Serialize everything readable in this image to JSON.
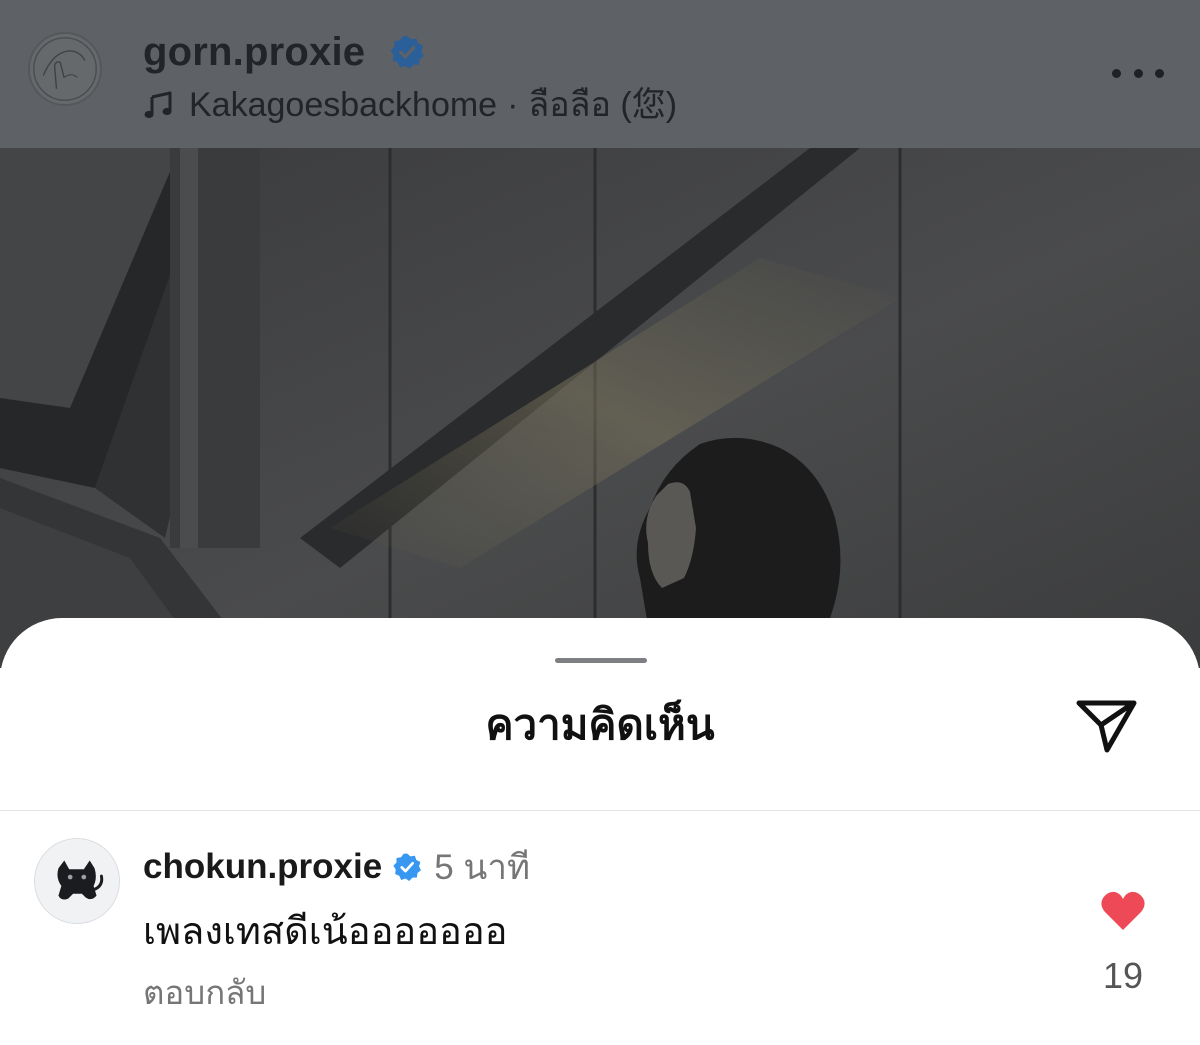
{
  "post_header": {
    "username": "gorn.proxie",
    "verified": true,
    "music": {
      "artist": "Kakagoesbackhome",
      "separator": "·",
      "title": "ลือลือ (您)"
    },
    "icons": {
      "avatar": "profile-avatar",
      "verified": "verified-badge-icon",
      "music": "music-note-icon",
      "more": "more-options-icon"
    }
  },
  "comments_sheet": {
    "title": "ความคิดเห็น",
    "share_icon": "send-icon",
    "comments": [
      {
        "username": "chokun.proxie",
        "verified": true,
        "time": "5 นาที",
        "text": "เพลงเทสดีเน้อออออออ",
        "reply_label": "ตอบกลับ",
        "likes": "19",
        "liked": true
      }
    ]
  },
  "colors": {
    "dim_overlay": "#5e6165",
    "verified_blue": "#3897f0",
    "like_red": "#ed4956",
    "secondary_text": "#767676"
  }
}
